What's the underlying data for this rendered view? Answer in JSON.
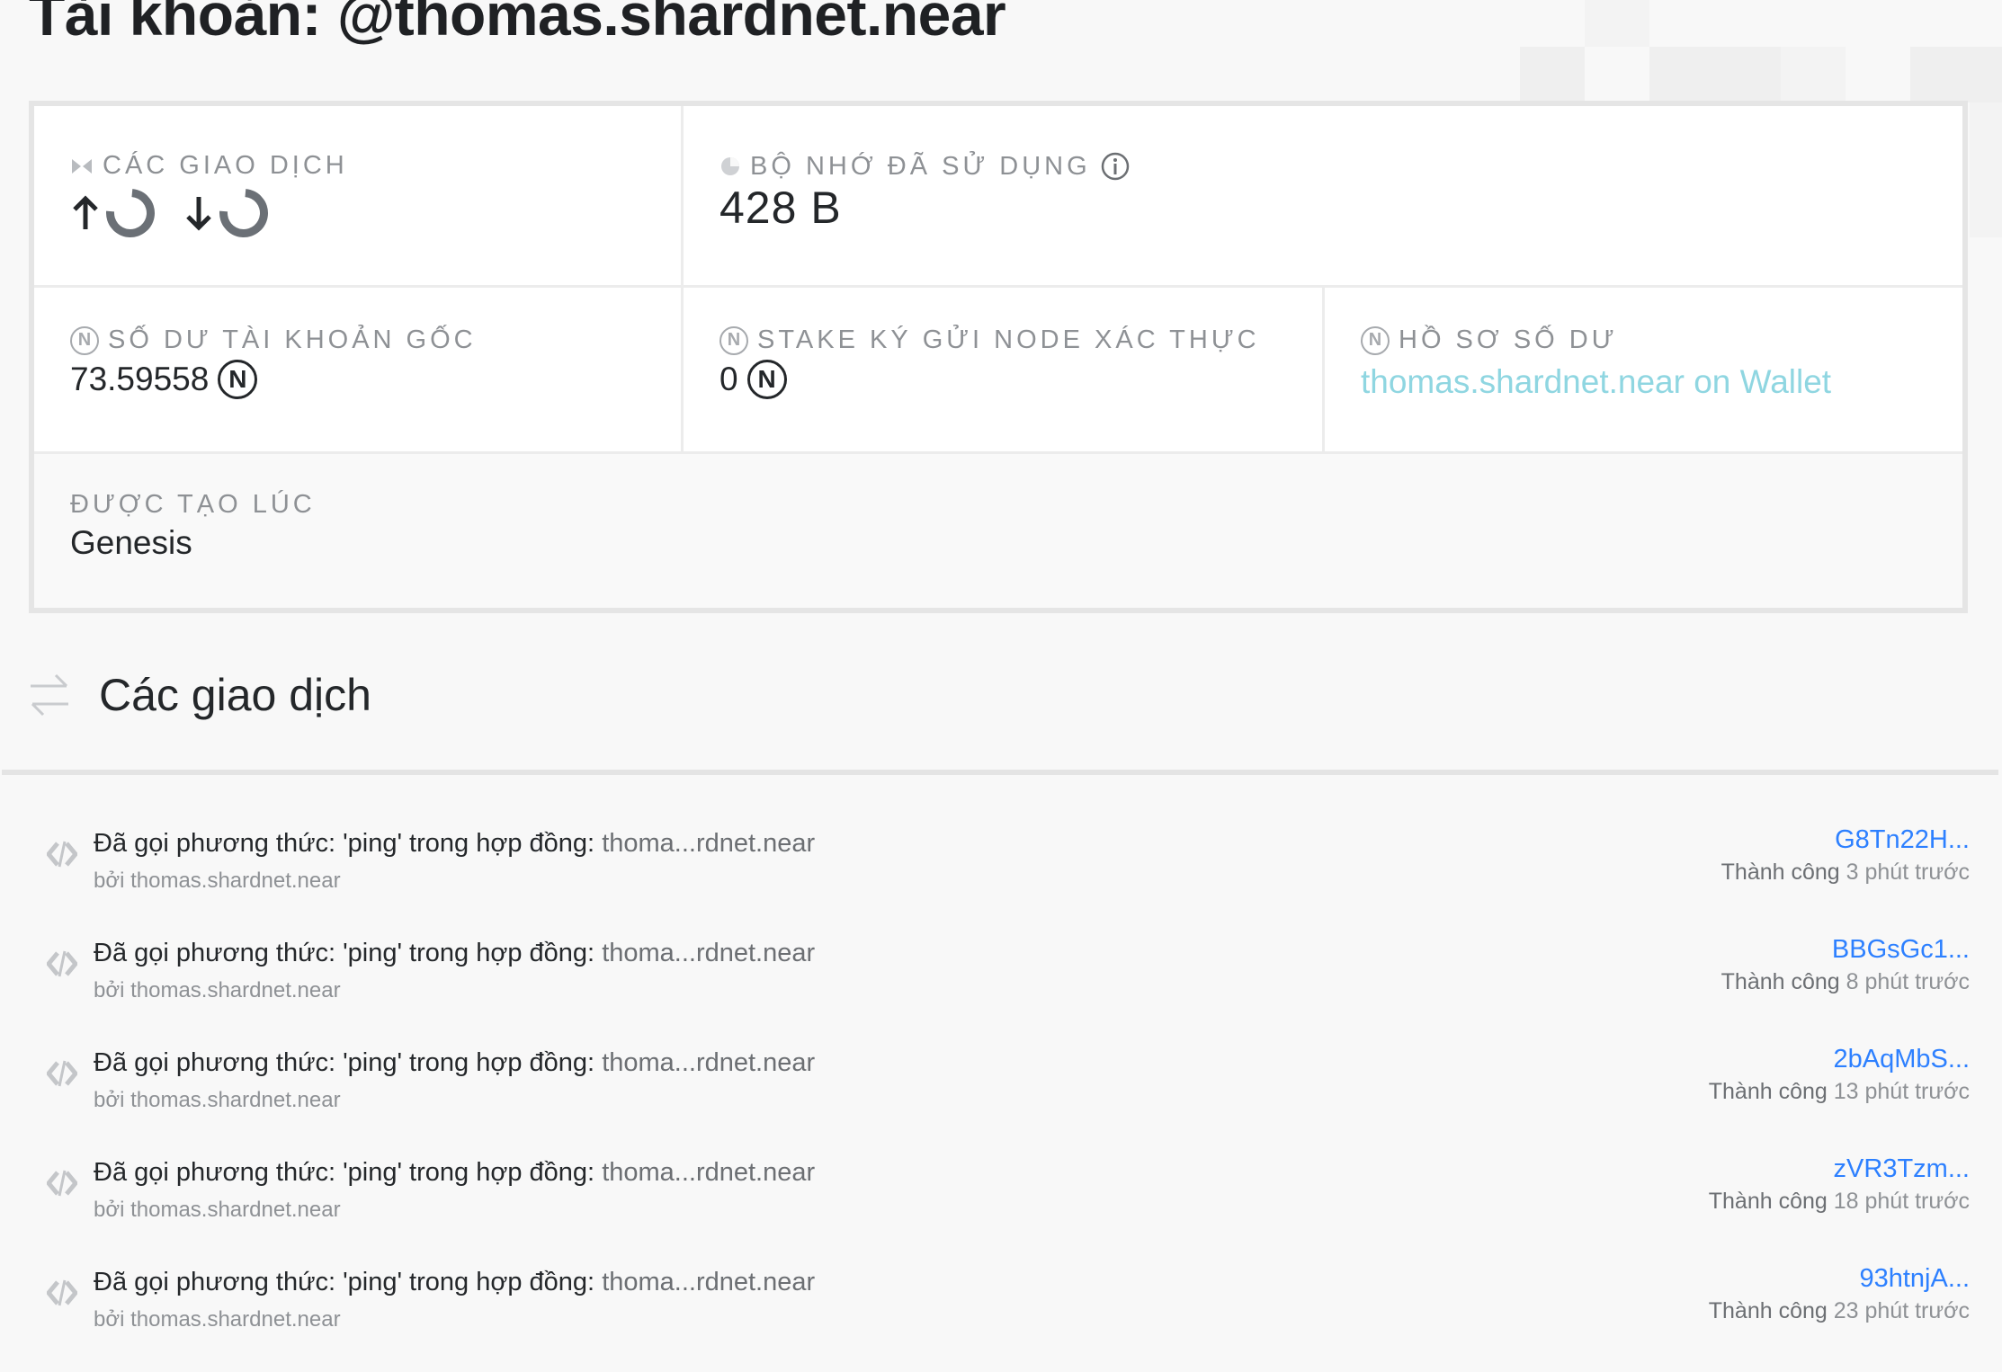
{
  "page": {
    "title": "Tài khoản: @thomas.shardnet.near"
  },
  "overview": {
    "transactions": {
      "label": "CÁC GIAO DỊCH"
    },
    "storage": {
      "label": "BỘ NHỚ ĐÃ SỬ DỤNG",
      "value": "428 B"
    },
    "native_balance": {
      "label": "SỐ DƯ TÀI KHOẢN GỐC",
      "value": "73.59558"
    },
    "validator_stake": {
      "label": "STAKE KÝ GỬI NODE XÁC THỰC",
      "value": "0"
    },
    "balance_profile": {
      "label": "HỒ SƠ SỐ DƯ",
      "link_text": "thomas.shardnet.near on Wallet"
    },
    "created_at": {
      "label": "ĐƯỢC TẠO LÚC",
      "value": "Genesis"
    }
  },
  "transactions": {
    "heading": "Các giao dịch",
    "items": [
      {
        "action": "Đã gọi phương thức: 'ping' trong hợp đồng: ",
        "contract": "thoma...rdnet.near",
        "by": "bởi thomas.shardnet.near",
        "hash": "G8Tn22H...",
        "status": "Thành công",
        "time": "3 phút trước"
      },
      {
        "action": "Đã gọi phương thức: 'ping' trong hợp đồng: ",
        "contract": "thoma...rdnet.near",
        "by": "bởi thomas.shardnet.near",
        "hash": "BBGsGc1...",
        "status": "Thành công",
        "time": "8 phút trước"
      },
      {
        "action": "Đã gọi phương thức: 'ping' trong hợp đồng: ",
        "contract": "thoma...rdnet.near",
        "by": "bởi thomas.shardnet.near",
        "hash": "2bAqMbS...",
        "status": "Thành công",
        "time": "13 phút trước"
      },
      {
        "action": "Đã gọi phương thức: 'ping' trong hợp đồng: ",
        "contract": "thoma...rdnet.near",
        "by": "bởi thomas.shardnet.near",
        "hash": "zVR3Tzm...",
        "status": "Thành công",
        "time": "18 phút trước"
      },
      {
        "action": "Đã gọi phương thức: 'ping' trong hợp đồng: ",
        "contract": "thoma...rdnet.near",
        "by": "bởi thomas.shardnet.near",
        "hash": "93htnjA...",
        "status": "Thành công",
        "time": "23 phút trước"
      }
    ]
  },
  "colors": {
    "accent_link": "#8fd6e1",
    "hash_link": "#2d80ff"
  },
  "icons": {
    "transactions": "transactions-icon",
    "storage": "storage-pie-icon",
    "near": "near-token-icon",
    "info": "info-icon",
    "section": "transfer-arrows-icon",
    "row": "code-brackets-icon"
  }
}
